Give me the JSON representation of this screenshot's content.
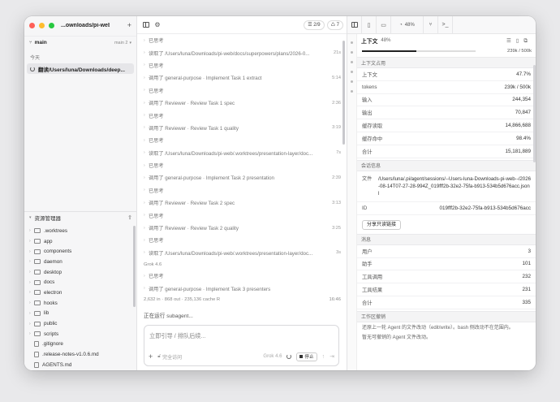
{
  "window": {
    "title": "...ownloads/pi-web"
  },
  "sidebar": {
    "branch": "main",
    "branch_right": "main 2",
    "today_label": "今天",
    "session_title": "翻读/Users/luna/Downloads/deep...",
    "explorer_title": "资源管理器",
    "tree": [
      {
        "name": ".worktrees",
        "type": "folder"
      },
      {
        "name": "app",
        "type": "folder"
      },
      {
        "name": "components",
        "type": "folder"
      },
      {
        "name": "daemon",
        "type": "folder"
      },
      {
        "name": "desktop",
        "type": "folder"
      },
      {
        "name": "docs",
        "type": "folder"
      },
      {
        "name": "electron",
        "type": "folder"
      },
      {
        "name": "hooks",
        "type": "folder"
      },
      {
        "name": "lib",
        "type": "folder"
      },
      {
        "name": "public",
        "type": "folder"
      },
      {
        "name": "scripts",
        "type": "folder"
      },
      {
        "name": ".gitignore",
        "type": "file"
      },
      {
        "name": ".release-notes-v1.0.6.md",
        "type": "file"
      },
      {
        "name": "AGENTS.md",
        "type": "file"
      }
    ]
  },
  "chat": {
    "toolbar": {
      "progress": "2/9",
      "count": "7"
    },
    "messages": [
      {
        "text": "已思考",
        "time": ""
      },
      {
        "text": "读取了 /Users/luna/Downloads/pi-web/docs/superpowers/plans/2026-0...",
        "time": "21s"
      },
      {
        "text": "已思考",
        "time": ""
      },
      {
        "text": "调用了 general-purpose · Implement Task 1 extract",
        "time": "5:14"
      },
      {
        "text": "已思考",
        "time": ""
      },
      {
        "text": "调用了 Reviewer · Review Task 1 spec",
        "time": "2:36"
      },
      {
        "text": "已思考",
        "time": ""
      },
      {
        "text": "调用了 Reviewer · Review Task 1 quality",
        "time": "3:19"
      },
      {
        "text": "已思考",
        "time": ""
      },
      {
        "text": "读取了 /Users/luna/Downloads/pi-web/.worktrees/presentation-layer/doc...",
        "time": "7s"
      },
      {
        "text": "已思考",
        "time": ""
      },
      {
        "text": "调用了 general-purpose · Implement Task 2 presentation",
        "time": "2:39"
      },
      {
        "text": "已思考",
        "time": ""
      },
      {
        "text": "调用了 Reviewer · Review Task 2 spec",
        "time": "3:13"
      },
      {
        "text": "已思考",
        "time": ""
      },
      {
        "text": "调用了 Reviewer · Review Task 2 quality",
        "time": "3:25"
      },
      {
        "text": "已思考",
        "time": ""
      },
      {
        "text": "读取了 /Users/luna/Downloads/pi-web/.worktrees/presentation-layer/doc...",
        "time": "3s"
      }
    ],
    "model_tag": "Grok 4.6",
    "messages_after": [
      {
        "text": "已思考",
        "time": ""
      },
      {
        "text": "调用了 general-purpose · Implement Task 3 presenters",
        "time": ""
      }
    ],
    "stats": "2,632 in · 868 out · 235,136 cache R",
    "stats_time": "16:46",
    "running": "正在运行 subagent...",
    "input_placeholder": "立即引导 / 排队后续...",
    "input_mode": "完全访问",
    "input_model": "Grok 4.6",
    "stop_label": "停止"
  },
  "panel": {
    "tab_percent": "48%",
    "title": "上下文",
    "title_pct": "48%",
    "progress_text": "239k / 500k",
    "progress_fraction": 0.48,
    "usage_section": "上下文占用",
    "usage": [
      {
        "k": "上下文",
        "v": "47.7%"
      },
      {
        "k": "tokens",
        "v": "239k / 500k"
      },
      {
        "k": "输入",
        "v": "244,354"
      },
      {
        "k": "输出",
        "v": "70,847"
      },
      {
        "k": "缓存读取",
        "v": "14,866,688"
      },
      {
        "k": "缓存命中",
        "v": "98.4%"
      },
      {
        "k": "合计",
        "v": "15,181,889"
      }
    ],
    "session_section": "会话信息",
    "file_label": "文件",
    "file_value": "/Users/luna/.pi/agent/sessions/--Users-luna-Downloads-pi-web--/2026-08-14T07-27-28-994Z_019fff2b-32e2-75fa-b913-534b5d676acc.jsonl",
    "id_label": "ID",
    "id_value": "019fff2b-32e2-75fa-b913-534b5d676acc",
    "share_label": "分享只读链接",
    "msg_section": "消息",
    "messages": [
      {
        "k": "用户",
        "v": "3"
      },
      {
        "k": "助手",
        "v": "101"
      },
      {
        "k": "工具调用",
        "v": "232"
      },
      {
        "k": "工具结果",
        "v": "231"
      },
      {
        "k": "合计",
        "v": "335"
      }
    ],
    "undo_section": "工作区撤销",
    "undo_note": "还原上一轮 Agent 的文件改动（edit/write）。bash 侧改动不在范围内。",
    "undo_note2": "暂无可撤销的 Agent 文件改动。"
  }
}
